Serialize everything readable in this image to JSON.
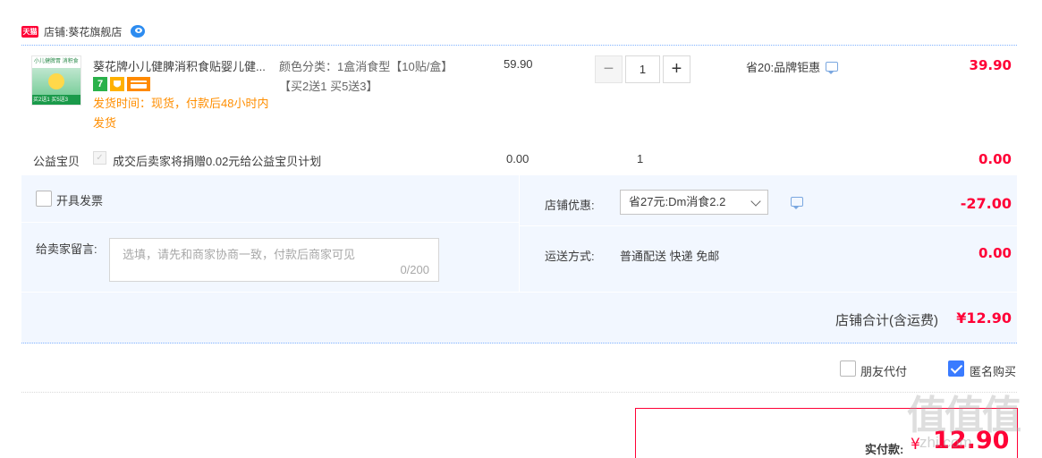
{
  "colors": {
    "accent": "#ff0036",
    "link_blue": "#3a7bff",
    "panel_bg": "#f2f7ff",
    "ship_time": "#ff8e00"
  },
  "store": {
    "badge": "天猫",
    "label": "店铺:",
    "name": "葵花旗舰店",
    "chat_icon": "wangwang-chat-icon"
  },
  "item": {
    "thumb": {
      "top_text": "小儿健脾胃 消积食",
      "bottom_text": "买2送1 买5送3"
    },
    "title": "葵花牌小儿健脾消积食贴婴儿健...",
    "badges": [
      "7",
      "",
      ""
    ],
    "ship_time": "发货时间：现货，付款后48小时内发货",
    "sku": "颜色分类：1盒消食型【10贴/盒】【买2送1 买5送3】",
    "unit_price": "59.90",
    "quantity": "1",
    "qty_minus": "−",
    "qty_plus": "+",
    "promo": "省20:品牌钜惠",
    "total": "39.90"
  },
  "charity": {
    "label": "公益宝贝",
    "check": "✓",
    "text": "成交后卖家将捐赠0.02元给公益宝贝计划",
    "price": "0.00",
    "qty": "1",
    "total": "0.00"
  },
  "invoice": {
    "label": "开具发票"
  },
  "message": {
    "label": "给卖家留言:",
    "placeholder": "选填，请先和商家协商一致，付款后商家可见",
    "count": "0/200"
  },
  "discount": {
    "label": "店铺优惠:",
    "selected": "省27元:Dm消食2.2",
    "amount": "-27.00"
  },
  "shipping": {
    "label": "运送方式:",
    "value": "普通配送 快递 免邮",
    "amount": "0.00"
  },
  "store_total": {
    "label": "店铺合计(含运费)",
    "amount": "¥12.90"
  },
  "options": {
    "friend_pay": "朋友代付",
    "anonymous": "匿名购买"
  },
  "pay": {
    "label": "实付款:",
    "currency": "¥",
    "amount": "12.90"
  },
  "watermark": {
    "text": "值值值",
    "url": "zhi.com"
  }
}
